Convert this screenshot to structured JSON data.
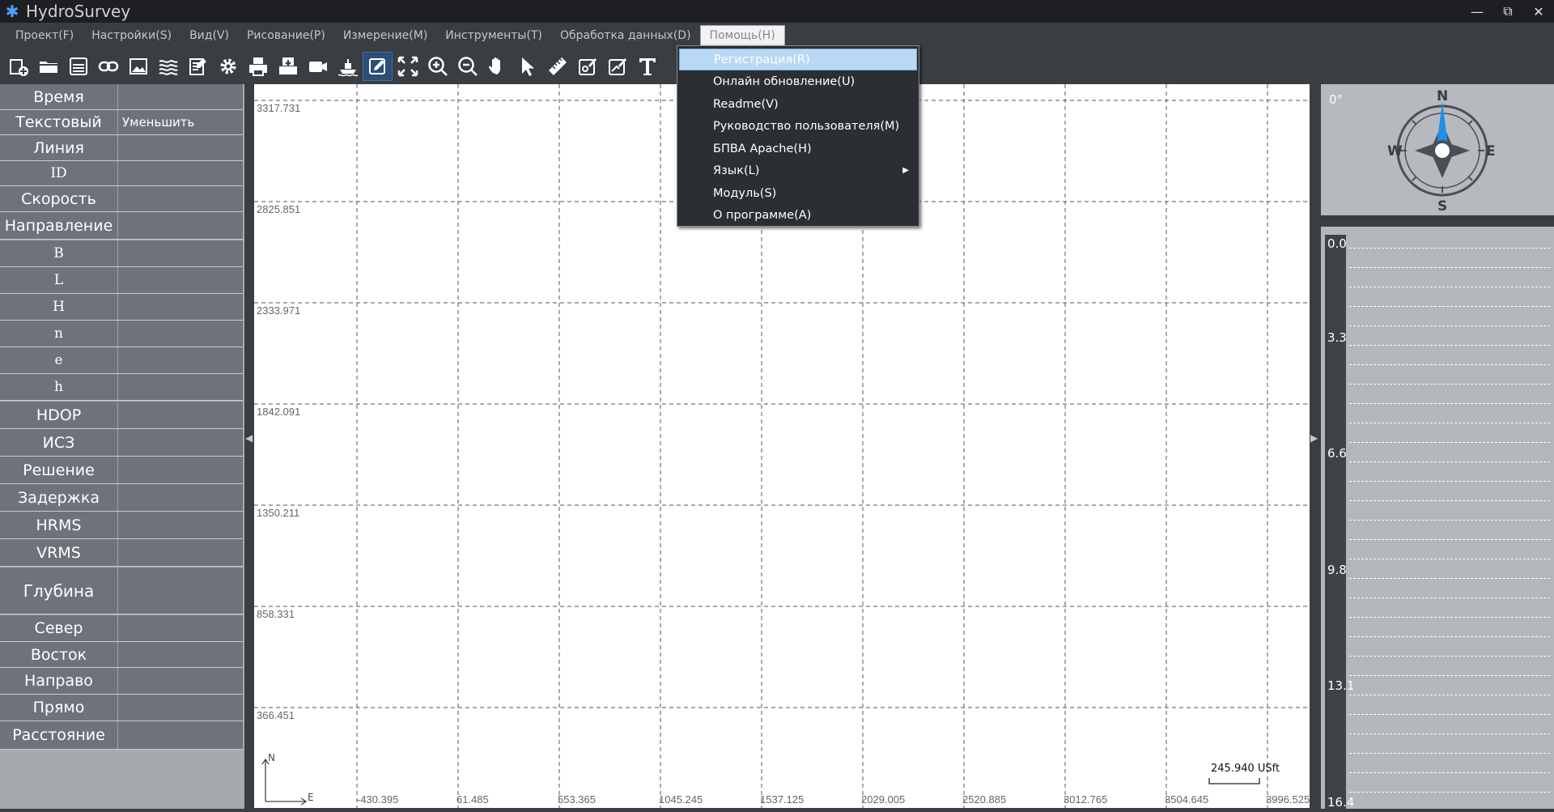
{
  "app": {
    "title": "HydroSurvey"
  },
  "window_buttons": [
    "minimize",
    "restore",
    "close"
  ],
  "menu": [
    {
      "label": "Проект(F)"
    },
    {
      "label": "Настройки(S)"
    },
    {
      "label": "Вид(V)"
    },
    {
      "label": "Рисование(P)"
    },
    {
      "label": "Измерение(M)"
    },
    {
      "label": "Инструменты(T)"
    },
    {
      "label": "Обработка данных(D)"
    },
    {
      "label": "Помощь(H)",
      "active": true
    }
  ],
  "help_menu": [
    {
      "label": "Регистрация(R)",
      "selected": true
    },
    {
      "label": "Онлайн обновление(U)"
    },
    {
      "label": "Readme(V)"
    },
    {
      "label": "Руководство пользователя(M)"
    },
    {
      "label": "БПВА Apache(H)"
    },
    {
      "label": "Язык(L)",
      "has_submenu": true
    },
    {
      "label": "Модуль(S)"
    },
    {
      "label": "О программе(A)"
    }
  ],
  "toolbar": [
    "new-project-icon",
    "open-folder-icon",
    "save-icon",
    "link-icon",
    "image-icon",
    "layers-icon",
    "document-edit-icon",
    "settings-gear-icon",
    "print-icon",
    "export-icon",
    "camera-icon",
    "boat-icon",
    "edit-pencil-icon",
    "fit-screen-icon",
    "zoom-in-icon",
    "zoom-out-icon",
    "pan-hand-icon",
    "select-pointer-icon",
    "ruler-icon",
    "edit-point-icon",
    "edit-line-icon",
    "text-icon"
  ],
  "left_panel": [
    {
      "label": "Время",
      "value": ""
    },
    {
      "label": "Текстовый",
      "value": "Уменьшить"
    },
    {
      "label": "Линия",
      "value": ""
    },
    {
      "label": "ID",
      "value": ""
    },
    {
      "label": "Скорость",
      "value": ""
    },
    {
      "label": "Направление",
      "value": ""
    },
    {
      "label": "B",
      "value": ""
    },
    {
      "label": "L",
      "value": ""
    },
    {
      "label": "H",
      "value": ""
    },
    {
      "label": "n",
      "value": ""
    },
    {
      "label": "e",
      "value": ""
    },
    {
      "label": "h",
      "value": ""
    },
    {
      "label": "HDOP",
      "value": ""
    },
    {
      "label": "ИСЗ",
      "value": ""
    },
    {
      "label": "Решение",
      "value": ""
    },
    {
      "label": "Задержка",
      "value": ""
    },
    {
      "label": "HRMS",
      "value": ""
    },
    {
      "label": "VRMS",
      "value": ""
    },
    {
      "label": "Глубина",
      "value": ""
    },
    {
      "label": "Север",
      "value": ""
    },
    {
      "label": "Восток",
      "value": ""
    },
    {
      "label": "Направо",
      "value": ""
    },
    {
      "label": "Прямо",
      "value": ""
    },
    {
      "label": "Расстояние",
      "value": ""
    }
  ],
  "map": {
    "y_ticks": [
      "3317.731",
      "2825.851",
      "2333.971",
      "1842.091",
      "1350.211",
      "858.331",
      "366.451"
    ],
    "x_ticks": [
      "-430.395",
      "61.485",
      "553.365",
      "1045.245",
      "1537.125",
      "2029.005",
      "2520.885",
      "3012.765",
      "3504.645",
      "3996.525"
    ],
    "north_label": "N",
    "east_label": "E",
    "scale_label": "245.940 USft"
  },
  "compass": {
    "heading": "0°",
    "n": "N",
    "e": "E",
    "s": "S",
    "w": "W"
  },
  "depth": {
    "labels": [
      "0.0",
      "3.3",
      "6.6",
      "9.8",
      "13.1",
      "16.4"
    ]
  }
}
